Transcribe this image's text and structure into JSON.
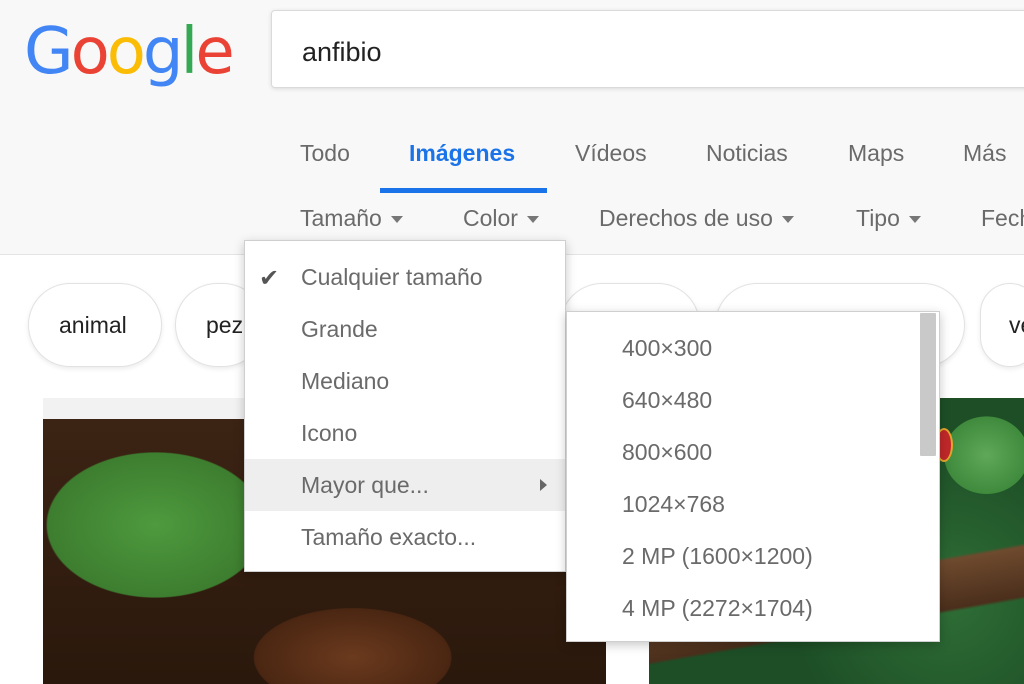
{
  "logo": {
    "text": "Google",
    "letters": [
      "G",
      "o",
      "o",
      "g",
      "l",
      "e"
    ],
    "colors": [
      "#4285f4",
      "#ea4335",
      "#fbbc05",
      "#4285f4",
      "#34a853",
      "#ea4335"
    ]
  },
  "search": {
    "query": "anfibio"
  },
  "tabs": [
    {
      "label": "Todo",
      "active": false
    },
    {
      "label": "Imágenes",
      "active": true
    },
    {
      "label": "Vídeos",
      "active": false
    },
    {
      "label": "Noticias",
      "active": false
    },
    {
      "label": "Maps",
      "active": false
    },
    {
      "label": "Más",
      "active": false
    }
  ],
  "accent_color": "#1a73e8",
  "tools": [
    {
      "label": "Tamaño"
    },
    {
      "label": "Color"
    },
    {
      "label": "Derechos de uso"
    },
    {
      "label": "Tipo"
    },
    {
      "label": "Fecha"
    }
  ],
  "chips": [
    "animal",
    "pez",
    "",
    "",
    "ve"
  ],
  "size_menu": {
    "items": [
      {
        "label": "Cualquier tamaño",
        "checked": true
      },
      {
        "label": "Grande",
        "checked": false
      },
      {
        "label": "Mediano",
        "checked": false
      },
      {
        "label": "Icono",
        "checked": false
      },
      {
        "label": "Mayor que...",
        "checked": false,
        "has_submenu": true,
        "highlighted": true
      },
      {
        "label": "Tamaño exacto...",
        "checked": false
      }
    ]
  },
  "larger_than_submenu": {
    "items": [
      "400×300",
      "640×480",
      "800×600",
      "1024×768",
      "2 MP (1600×1200)",
      "4 MP (2272×1704)"
    ]
  },
  "icons": {
    "check": "checkmark-icon",
    "submenu_arrow": "chevron-right-icon",
    "caret": "caret-down-icon"
  }
}
